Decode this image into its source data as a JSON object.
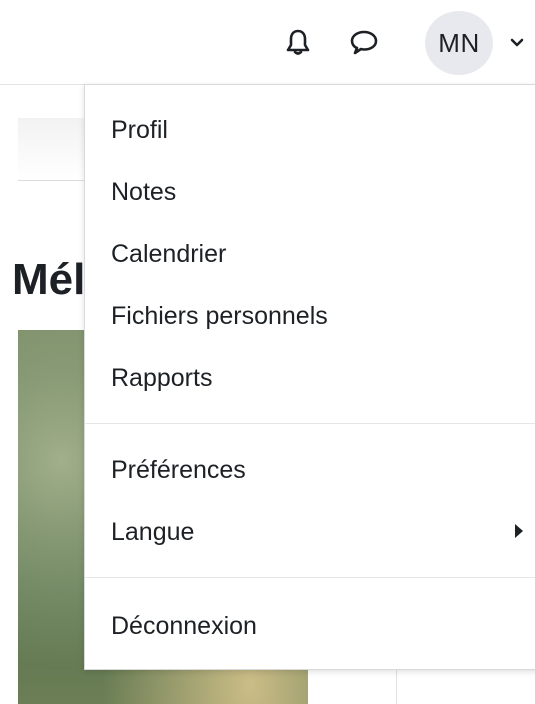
{
  "navbar": {
    "notifications_icon": "bell-icon",
    "messages_icon": "chat-bubble-icon",
    "avatar_initials": "MN",
    "menu_toggle_icon": "chevron-down-icon"
  },
  "background": {
    "heading_fragment": "Mél"
  },
  "user_menu": {
    "items": [
      {
        "label": "Profil"
      },
      {
        "label": "Notes"
      },
      {
        "label": "Calendrier"
      },
      {
        "label": "Fichiers personnels"
      },
      {
        "label": "Rapports"
      },
      {
        "label": "Préférences"
      },
      {
        "label": "Langue",
        "has_submenu": true,
        "submenu_icon": "caret-right-icon"
      },
      {
        "label": "Déconnexion"
      }
    ]
  }
}
